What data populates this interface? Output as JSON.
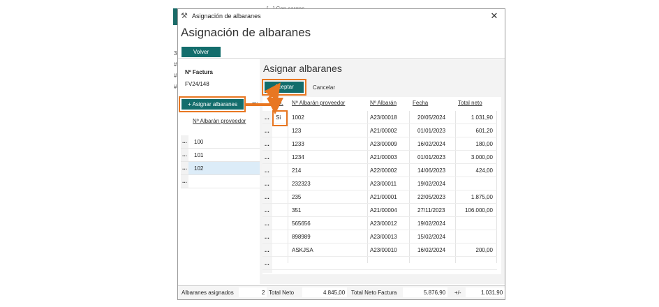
{
  "background": {
    "title_fragment": "[...] Con cargos",
    "digits": [
      "3",
      "#",
      "#",
      "#"
    ]
  },
  "window": {
    "title": "Asignación de albaranes",
    "close": "✕"
  },
  "header": {
    "title": "Asignación de albaranes",
    "volver_label": "Volver"
  },
  "left_panel": {
    "factura_label": "Nº Factura",
    "factura_value": "FV24/148",
    "asignar_label": "+ Asignar albaranes",
    "eliminar_label": "Elim",
    "column_header": "Nº Albarán proveedor",
    "rows": [
      "100",
      "101",
      "102",
      ""
    ],
    "selected_row": 2
  },
  "right_panel": {
    "title": "Asignar albaranes",
    "aceptar_label": "Aceptar",
    "cancelar_label": "Cancelar",
    "columns": {
      "sel": "Sel.",
      "prov": "Nº Albarán proveedor",
      "alb": "Nº Albarán",
      "fecha": "Fecha",
      "total": "Total neto"
    },
    "rows": [
      {
        "sel": "Si",
        "prov": "1002",
        "alb": "A23/00018",
        "fecha": "20/05/2024",
        "total": "1.031,90"
      },
      {
        "sel": "",
        "prov": "123",
        "alb": "A21/00002",
        "fecha": "01/01/2023",
        "total": "601,20"
      },
      {
        "sel": "",
        "prov": "1233",
        "alb": "A23/00009",
        "fecha": "16/02/2024",
        "total": "180,00"
      },
      {
        "sel": "",
        "prov": "1234",
        "alb": "A21/00003",
        "fecha": "01/01/2023",
        "total": "3.000,00"
      },
      {
        "sel": "",
        "prov": "214",
        "alb": "A22/00002",
        "fecha": "14/06/2023",
        "total": "424,00"
      },
      {
        "sel": "",
        "prov": "232323",
        "alb": "A23/00011",
        "fecha": "19/02/2024",
        "total": ""
      },
      {
        "sel": "",
        "prov": "235",
        "alb": "A21/00001",
        "fecha": "22/05/2023",
        "total": "1.875,00"
      },
      {
        "sel": "",
        "prov": "351",
        "alb": "A21/00004",
        "fecha": "27/11/2023",
        "total": "106.000,00"
      },
      {
        "sel": "",
        "prov": "565656",
        "alb": "A23/00012",
        "fecha": "19/02/2024",
        "total": ""
      },
      {
        "sel": "",
        "prov": "898989",
        "alb": "A23/00013",
        "fecha": "15/02/2024",
        "total": ""
      },
      {
        "sel": "",
        "prov": "ASKJSA",
        "alb": "A23/00010",
        "fecha": "16/02/2024",
        "total": "200,00"
      },
      {
        "sel": "",
        "prov": "",
        "alb": "",
        "fecha": "",
        "total": ""
      }
    ]
  },
  "footer": {
    "asignados_label": "Albaranes asignados",
    "asignados_value": "2",
    "total_neto_label": "Total Neto",
    "total_neto_value": "4.845,00",
    "total_factura_label": "Total Neto Factura",
    "total_factura_value": "5.876,90",
    "diff_label": "+/-",
    "diff_value": "1.031,90"
  },
  "colors": {
    "accent": "#136d6c",
    "highlight": "#e87722",
    "selected_row": "#dcecf8"
  },
  "icons": {
    "window": "tools-icon",
    "row_menu": "ellipsis-icon"
  }
}
